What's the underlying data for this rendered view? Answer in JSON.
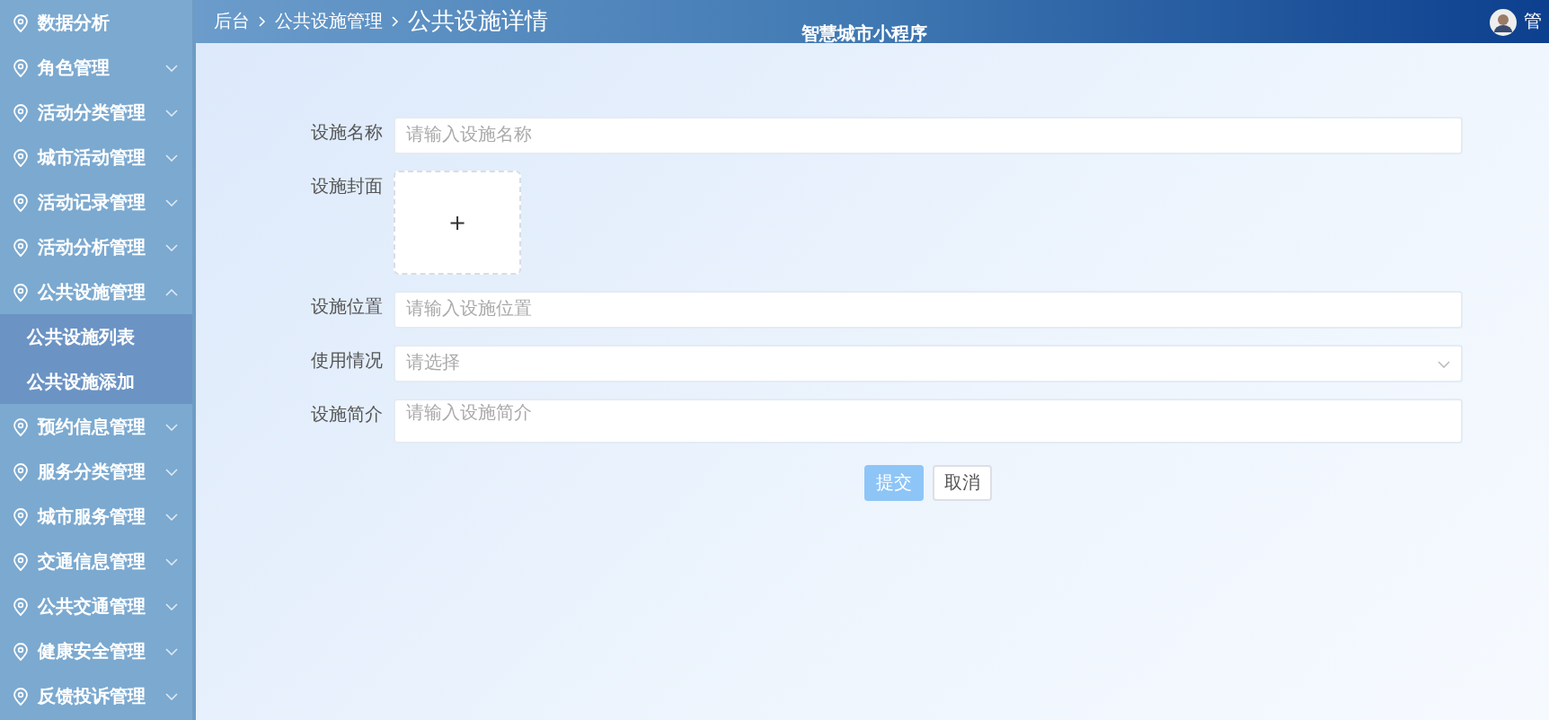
{
  "sidebar": {
    "items": [
      {
        "label": "数据分析",
        "expandable": false
      },
      {
        "label": "角色管理",
        "expandable": true,
        "expanded": false
      },
      {
        "label": "活动分类管理",
        "expandable": true,
        "expanded": false
      },
      {
        "label": "城市活动管理",
        "expandable": true,
        "expanded": false
      },
      {
        "label": "活动记录管理",
        "expandable": true,
        "expanded": false
      },
      {
        "label": "活动分析管理",
        "expandable": true,
        "expanded": false
      },
      {
        "label": "公共设施管理",
        "expandable": true,
        "expanded": true,
        "children": [
          {
            "label": "公共设施列表"
          },
          {
            "label": "公共设施添加"
          }
        ]
      },
      {
        "label": "预约信息管理",
        "expandable": true,
        "expanded": false
      },
      {
        "label": "服务分类管理",
        "expandable": true,
        "expanded": false
      },
      {
        "label": "城市服务管理",
        "expandable": true,
        "expanded": false
      },
      {
        "label": "交通信息管理",
        "expandable": true,
        "expanded": false
      },
      {
        "label": "公共交通管理",
        "expandable": true,
        "expanded": false
      },
      {
        "label": "健康安全管理",
        "expandable": true,
        "expanded": false
      },
      {
        "label": "反馈投诉管理",
        "expandable": true,
        "expanded": false
      }
    ]
  },
  "header": {
    "breadcrumb": [
      "后台",
      "公共设施管理"
    ],
    "page_title": "公共设施详情",
    "app_title": "智慧城市小程序",
    "user": "管"
  },
  "form": {
    "fields": [
      {
        "kind": "input",
        "label": "设施名称",
        "placeholder": "请输入设施名称"
      },
      {
        "kind": "upload",
        "label": "设施封面",
        "icon": "+"
      },
      {
        "kind": "input",
        "label": "设施位置",
        "placeholder": "请输入设施位置"
      },
      {
        "kind": "select",
        "label": "使用情况",
        "placeholder": "请选择"
      },
      {
        "kind": "textarea",
        "label": "设施简介",
        "placeholder": "请输入设施简介"
      }
    ],
    "buttons": [
      {
        "label": "提交",
        "kind": "primary"
      },
      {
        "label": "取消",
        "kind": "default"
      }
    ]
  }
}
